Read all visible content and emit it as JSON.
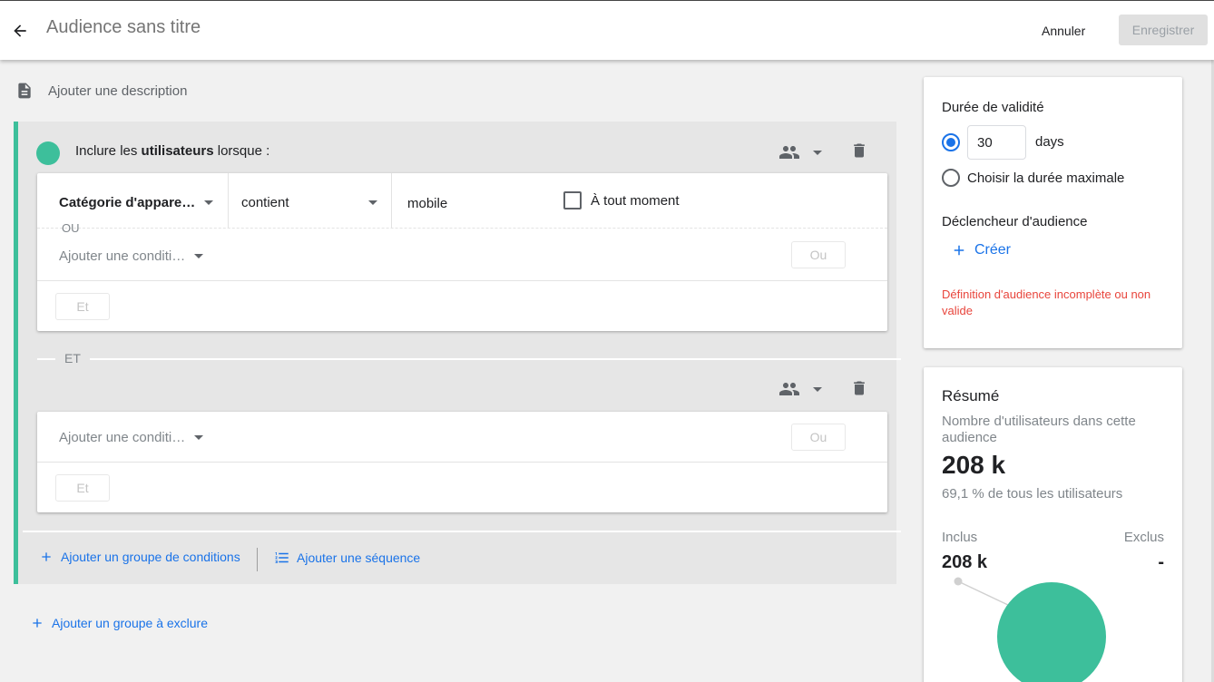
{
  "header": {
    "title": "Audience sans titre",
    "cancel_label": "Annuler",
    "save_label": "Enregistrer"
  },
  "description": {
    "label": "Ajouter une description"
  },
  "include_group": {
    "prefix": "Inclure les ",
    "bold": "utilisateurs",
    "suffix": " lorsque :",
    "card1": {
      "dimension": "Catégorie d'appare…",
      "operator": "contient",
      "value": "mobile",
      "anytime_label": "À tout moment",
      "anytime_checked": false,
      "or_label": "OU",
      "add_condition_placeholder": "Ajouter une conditi…",
      "or_button": "Ou",
      "and_button": "Et"
    },
    "and_separator": "ET",
    "card2": {
      "add_condition_placeholder": "Ajouter une conditi…",
      "or_button": "Ou",
      "and_button": "Et"
    },
    "add_condition_group": "Ajouter un groupe de conditions",
    "add_sequence": "Ajouter une séquence"
  },
  "add_exclude_group": "Ajouter un groupe à exclure",
  "validity": {
    "title": "Durée de validité",
    "days_value": "30",
    "days_unit": "days",
    "max_label": "Choisir la durée maximale",
    "selected": "days",
    "trigger_title": "Déclencheur d'audience",
    "create_label": "Créer",
    "error": "Définition d'audience incomplète ou non valide"
  },
  "summary": {
    "title": "Résumé",
    "subtitle": "Nombre d'utilisateurs dans cette audience",
    "count": "208 k",
    "percent": "69,1 % de tous les utilisateurs",
    "included_label": "Inclus",
    "excluded_label": "Exclus",
    "included_value": "208 k",
    "excluded_value": "-"
  },
  "colors": {
    "accent_green": "#3dbf9b",
    "link_blue": "#1a73e8",
    "error_red": "#e8453c"
  },
  "icons": [
    "back-arrow-icon",
    "description-icon",
    "people-icon",
    "trash-icon",
    "plus-icon",
    "sequence-icon"
  ]
}
